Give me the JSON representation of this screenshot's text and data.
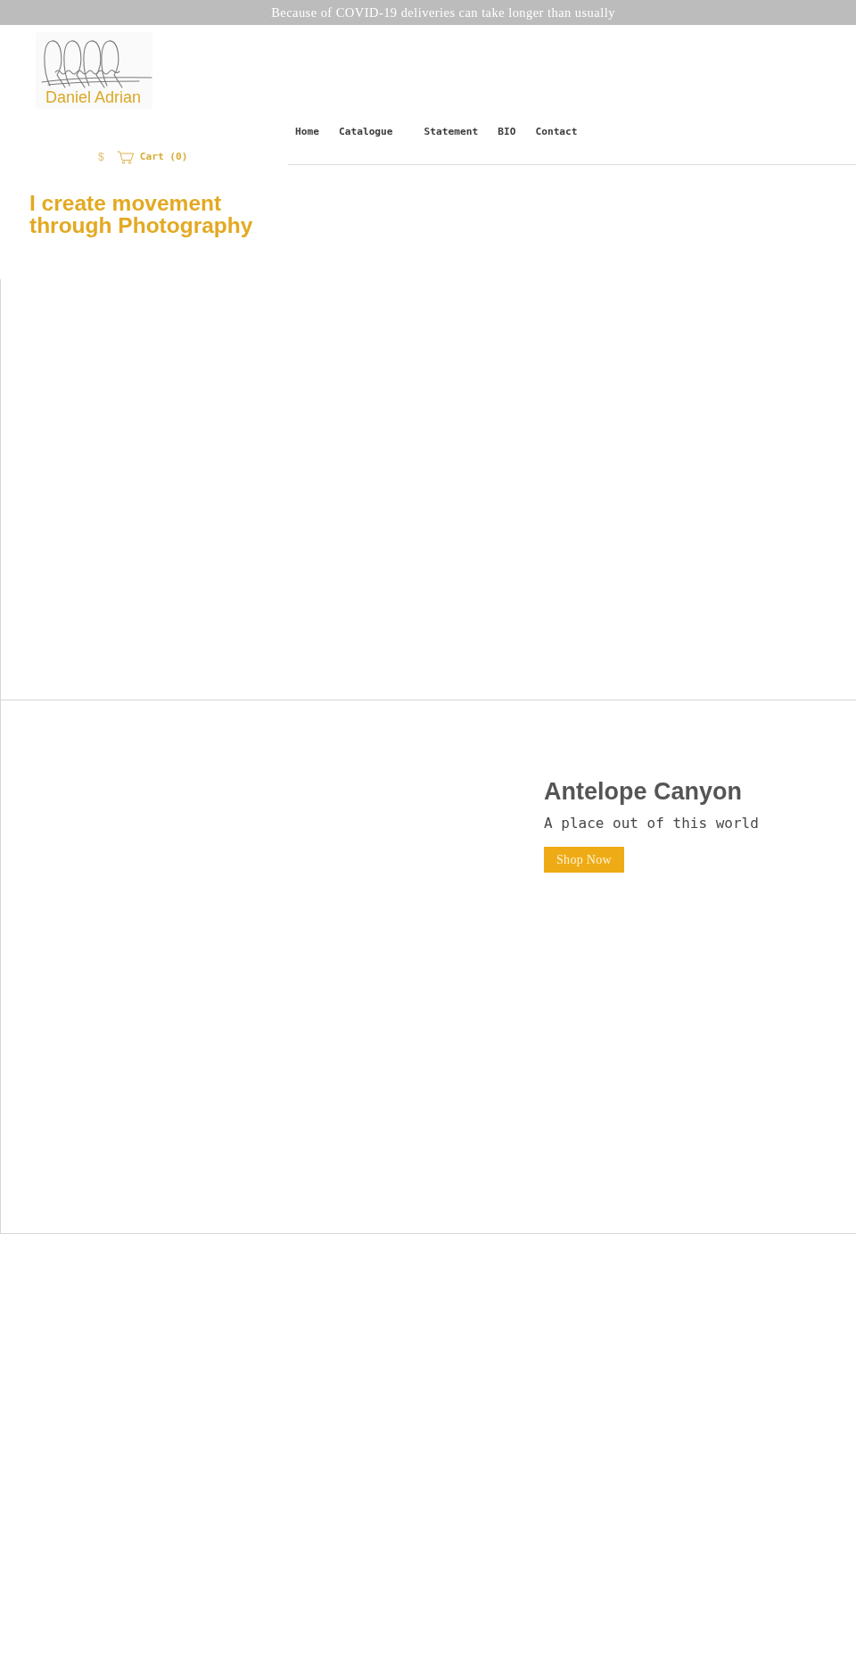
{
  "announcement_bar": {
    "text": "Because of COVID-19 deliveries can take longer than usually"
  },
  "header": {
    "logo": {
      "text": "Daniel Adrian"
    },
    "nav": [
      {
        "label": "Home"
      },
      {
        "label": "Catalogue"
      },
      {
        "label": "Statement"
      },
      {
        "label": "BIO"
      },
      {
        "label": "Contact"
      }
    ],
    "currency": {
      "symbol": "$"
    },
    "cart": {
      "label": "Cart (0)"
    }
  },
  "hero": {
    "headline": "I create movement through Photography"
  },
  "feature": {
    "title": "Antelope Canyon",
    "subtitle": "A place out of this world",
    "button": "Shop Now"
  }
}
